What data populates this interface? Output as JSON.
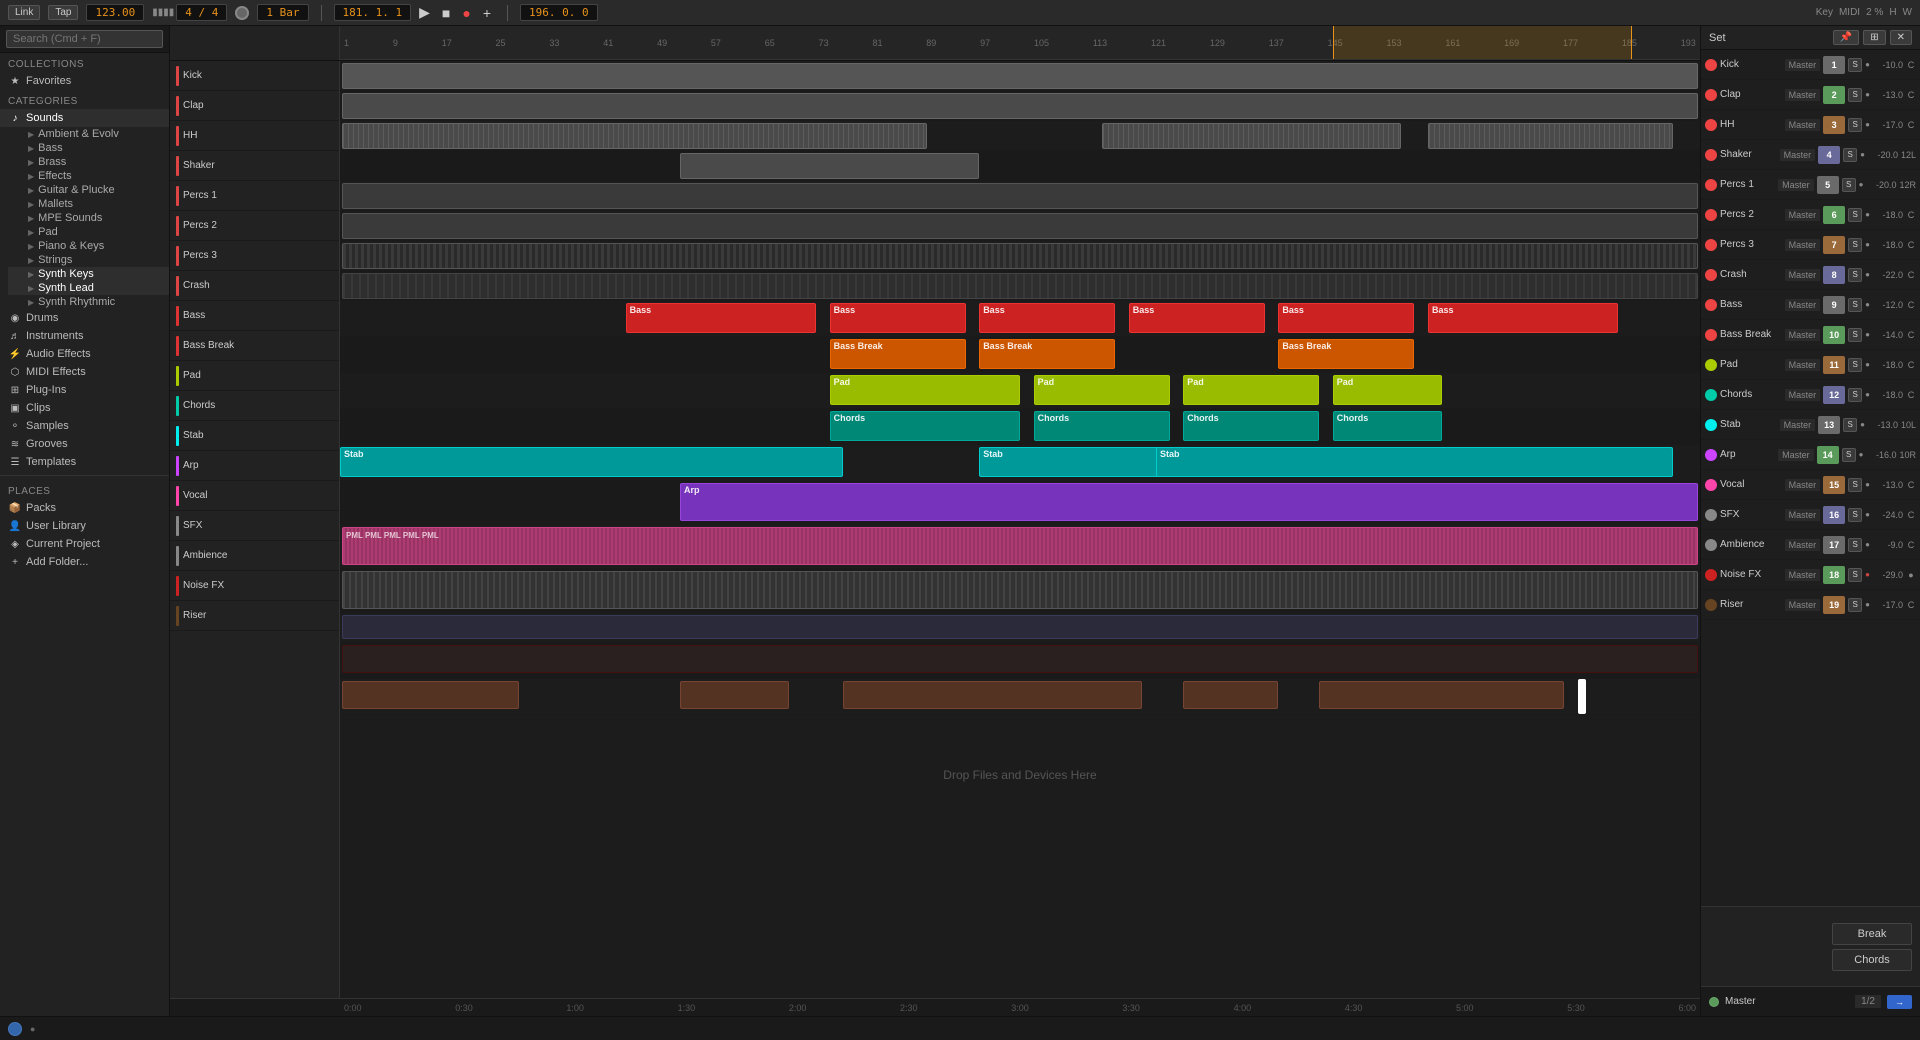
{
  "topbar": {
    "link_label": "Link",
    "tap_label": "Tap",
    "bpm": "123.00",
    "time_sig": "4 / 4",
    "loop_start": "181. 1. 1",
    "loop_end": "196. 0. 0",
    "bar_label": "1 Bar",
    "key_label": "Key",
    "midi_label": "MIDI",
    "zoom_label": "2 %",
    "hw_label": "H",
    "w_label": "W"
  },
  "search": {
    "placeholder": "Search (Cmd + F)"
  },
  "sidebar": {
    "collections_label": "Collections",
    "favorites_label": "Favorites",
    "categories_label": "Categories",
    "sounds_label": "Sounds",
    "drums_label": "Drums",
    "instruments_label": "Instruments",
    "audio_effects_label": "Audio Effects",
    "midi_effects_label": "MIDI Effects",
    "plug_ins_label": "Plug-Ins",
    "clips_label": "Clips",
    "samples_label": "Samples",
    "grooves_label": "Grooves",
    "templates_label": "Templates",
    "places_label": "Places",
    "packs_label": "Packs",
    "user_library_label": "User Library",
    "current_project_label": "Current Project",
    "add_folder_label": "Add Folder...",
    "sounds_subcategories": [
      "Ambient & Evolv",
      "Bass",
      "Brass",
      "Effects",
      "Guitar & Plucke",
      "Mallets",
      "MPE Sounds",
      "Pad",
      "Piano & Keys",
      "Strings",
      "Synth Keys",
      "Synth Lead",
      "Synth Rhythmic"
    ]
  },
  "tracks": [
    {
      "name": "Kick",
      "color": "#e44",
      "num": 1,
      "vol": "-10.0",
      "pan": "C",
      "route": "Master"
    },
    {
      "name": "Clap",
      "color": "#e44",
      "num": 2,
      "vol": "-13.0",
      "pan": "C",
      "route": "Master"
    },
    {
      "name": "HH",
      "color": "#e44",
      "num": 3,
      "vol": "-17.0",
      "pan": "C",
      "route": "Master"
    },
    {
      "name": "Shaker",
      "color": "#e44",
      "num": 4,
      "vol": "-20.0",
      "pan": "12L",
      "route": "Master"
    },
    {
      "name": "Percs 1",
      "color": "#e44",
      "num": 5,
      "vol": "-20.0",
      "pan": "12R",
      "route": "Master"
    },
    {
      "name": "Percs 2",
      "color": "#e44",
      "num": 6,
      "vol": "-18.0",
      "pan": "C",
      "route": "Master"
    },
    {
      "name": "Percs 3",
      "color": "#e44",
      "num": 7,
      "vol": "-18.0",
      "pan": "C",
      "route": "Master"
    },
    {
      "name": "Crash",
      "color": "#e44",
      "num": 8,
      "vol": "-22.0",
      "pan": "C",
      "route": "Master"
    },
    {
      "name": "Bass",
      "color": "#e44",
      "num": 9,
      "vol": "-12.0",
      "pan": "C",
      "route": "Master"
    },
    {
      "name": "Bass Break",
      "color": "#e44",
      "num": 10,
      "vol": "-14.0",
      "pan": "C",
      "route": "Master"
    },
    {
      "name": "Pad",
      "color": "#aacc00",
      "num": 11,
      "vol": "-18.0",
      "pan": "C",
      "route": "Master"
    },
    {
      "name": "Chords",
      "color": "#00ccaa",
      "num": 12,
      "vol": "-18.0",
      "pan": "C",
      "route": "Master"
    },
    {
      "name": "Stab",
      "color": "#00eeee",
      "num": 13,
      "vol": "-13.0",
      "pan": "10L",
      "route": "Master"
    },
    {
      "name": "Arp",
      "color": "#cc44ff",
      "num": 14,
      "vol": "-16.0",
      "pan": "10R",
      "route": "Master"
    },
    {
      "name": "Vocal",
      "color": "#ff44aa",
      "num": 15,
      "vol": "-13.0",
      "pan": "C",
      "route": "Master"
    },
    {
      "name": "SFX",
      "color": "#888888",
      "num": 16,
      "vol": "-24.0",
      "pan": "C",
      "route": "Master"
    },
    {
      "name": "Ambience",
      "color": "#888888",
      "num": 17,
      "vol": "-9.0",
      "pan": "C",
      "route": "Master"
    },
    {
      "name": "Noise FX",
      "color": "#cc2222",
      "num": 18,
      "vol": "-29.0",
      "pan": "●",
      "route": "Master"
    },
    {
      "name": "Riser",
      "color": "#664422",
      "num": 19,
      "vol": "-17.0",
      "pan": "C",
      "route": "Master"
    }
  ],
  "ruler": {
    "marks": [
      "1",
      "9",
      "17",
      "25",
      "33",
      "41",
      "49",
      "57",
      "65",
      "73",
      "81",
      "89",
      "97",
      "105",
      "113",
      "121",
      "129",
      "137",
      "145",
      "153",
      "161",
      "169",
      "177",
      "185",
      "193"
    ]
  },
  "timeline_bottom": {
    "marks": [
      "0:00",
      "0:30",
      "1:00",
      "1:30",
      "2:00",
      "2:30",
      "3:00",
      "3:30",
      "4:00",
      "4:30",
      "5:00",
      "5:30",
      "6:00"
    ]
  },
  "mixer": {
    "set_label": "Set"
  },
  "context_menu": {
    "break_label": "Break",
    "chords_label": "Chords"
  },
  "drop_hint": "Drop Files and Devices Here",
  "bottom": {
    "master_label": "Master",
    "page_label": "1/2"
  }
}
